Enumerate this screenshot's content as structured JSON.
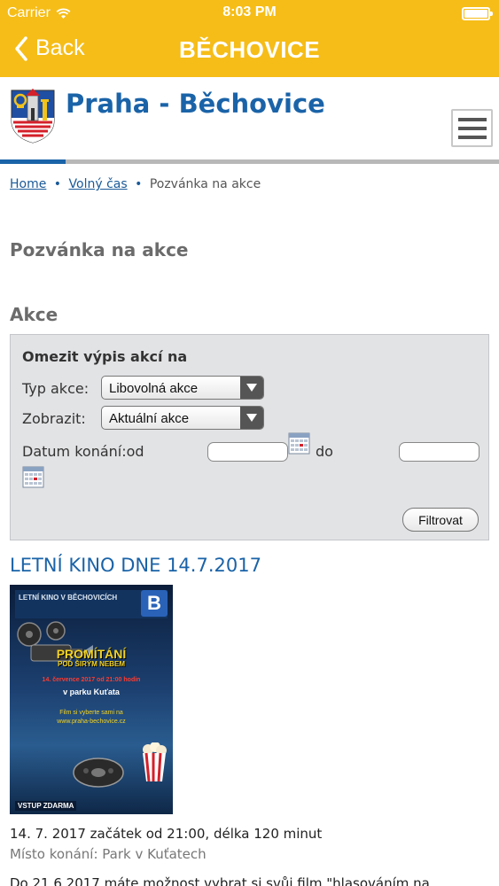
{
  "status_bar": {
    "carrier": "Carrier",
    "time": "8:03 PM"
  },
  "nav": {
    "back_label": "Back",
    "title": "BĚCHOVICE"
  },
  "site": {
    "title": "Praha - Běchovice"
  },
  "breadcrumb": {
    "home": "Home",
    "sep1": "•",
    "free_time": "Volný čas",
    "sep2": "•",
    "current": "Pozvánka na akce"
  },
  "page_title": "Pozvánka na akce",
  "section_title": "Akce",
  "filter": {
    "title": "Omezit výpis akcí na",
    "type_label": "Typ akce:",
    "type_value": "Libovolná akce",
    "show_label": "Zobrazit:",
    "show_value": "Aktuální akce",
    "date_from_label": "Datum konání:od",
    "date_to_label": "do",
    "submit_label": "Filtrovat"
  },
  "event": {
    "title": "LETNÍ KINO DNE 14.7.2017",
    "date_line": "14. 7. 2017 začátek od 21:00, délka 120 minut",
    "place_line": "Místo konání: Park v Kuťatech",
    "desc_line": "Do 21.6.2017 máte možnost vybrat si svůj film \"hlasováním na",
    "poster": {
      "header": "LETNÍ KINO V BĚCHOVICÍCH",
      "logo": "B",
      "main_line1": "PROMÍTÁNÍ",
      "main_line2": "POD ŠIRÝM NEBEM",
      "date": "14. července 2017 od 21:00 hodin",
      "place": "v parku Kuťata",
      "web_line1": "Film si vyberte sami na",
      "web_line2": "www.praha-bechovice.cz",
      "footer": "VSTUP ZDARMA"
    }
  },
  "colors": {
    "nav_bar": "#f6bd18",
    "brand_blue": "#1a63a8",
    "filter_bg": "#e2e3e5"
  }
}
